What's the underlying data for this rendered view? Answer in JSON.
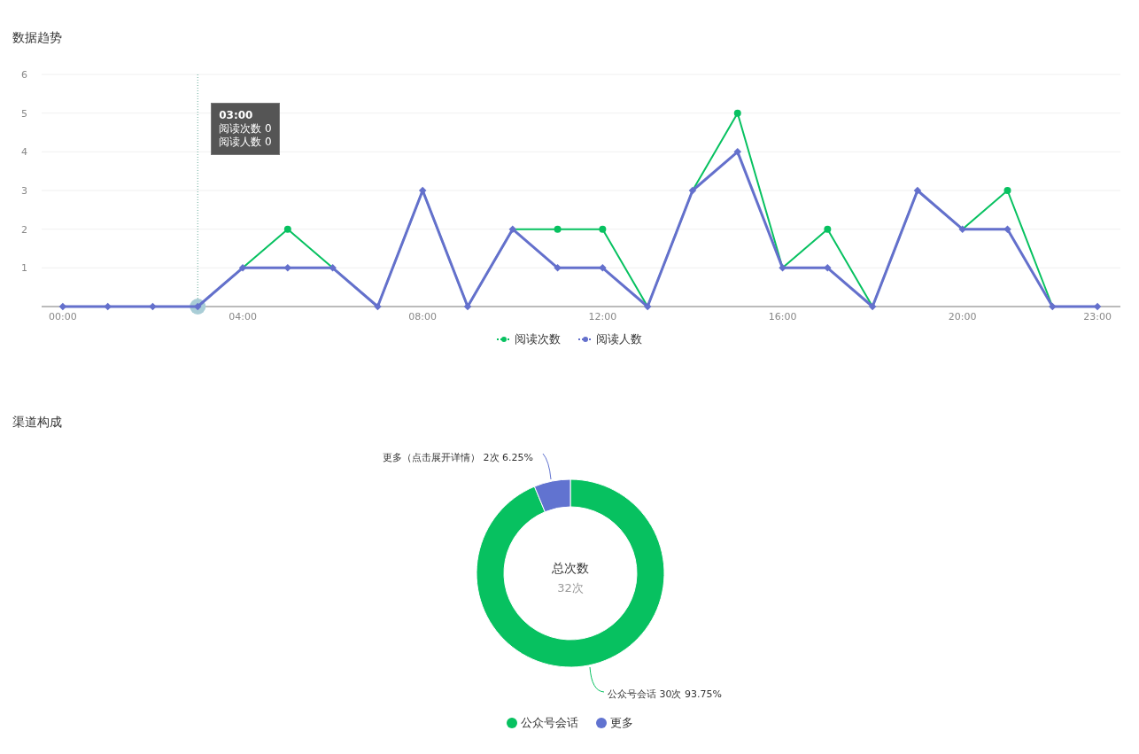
{
  "trend": {
    "title": "数据趋势",
    "chart_data": {
      "type": "line",
      "x": [
        0,
        1,
        2,
        3,
        4,
        5,
        6,
        7,
        8,
        9,
        10,
        11,
        12,
        13,
        14,
        15,
        16,
        17,
        18,
        19,
        20,
        21,
        22,
        23
      ],
      "xticks": [
        {
          "value": 0,
          "label": "00:00"
        },
        {
          "value": 4,
          "label": "04:00"
        },
        {
          "value": 8,
          "label": "08:00"
        },
        {
          "value": 12,
          "label": "12:00"
        },
        {
          "value": 16,
          "label": "16:00"
        },
        {
          "value": 20,
          "label": "20:00"
        },
        {
          "value": 23,
          "label": "23:00"
        }
      ],
      "xlim": [
        -0.47,
        23.51
      ],
      "yticks": [
        1,
        2,
        3,
        4,
        5,
        6
      ],
      "ylim": [
        0,
        6
      ],
      "grid": true,
      "ref_lines": [
        {
          "axis": "x",
          "value": 3
        }
      ],
      "series": [
        {
          "name": "阅读次数",
          "color": "#07c160",
          "values": [
            null,
            null,
            null,
            0,
            1,
            2,
            1,
            0,
            3,
            0,
            2,
            2,
            2,
            0,
            3,
            5,
            1,
            2,
            0,
            3,
            2,
            3,
            0,
            0
          ]
        },
        {
          "name": "阅读人数",
          "color": "#6470cc",
          "marker": "diamond",
          "values": [
            0,
            0,
            0,
            0,
            1,
            1,
            1,
            0,
            3,
            0,
            2,
            1,
            1,
            0,
            3,
            4,
            1,
            1,
            0,
            3,
            2,
            2,
            0,
            0
          ]
        }
      ]
    },
    "tooltip": {
      "title": "03:00",
      "rows": [
        {
          "name": "阅读次数",
          "value": "0"
        },
        {
          "name": "阅读人数",
          "value": "0"
        }
      ]
    }
  },
  "channels": {
    "title": "渠道构成",
    "chart_data": {
      "type": "donut",
      "categories": [
        "公众号会话",
        "更多"
      ],
      "values": [
        30,
        2
      ],
      "colors": [
        "#07c160",
        "#6173d0"
      ],
      "value_labels": [
        "公众号会话 30次 93.75%",
        "更多（点击展开详情） 2次 6.25%"
      ]
    },
    "center_title": "总次数",
    "center_value": "32次"
  }
}
